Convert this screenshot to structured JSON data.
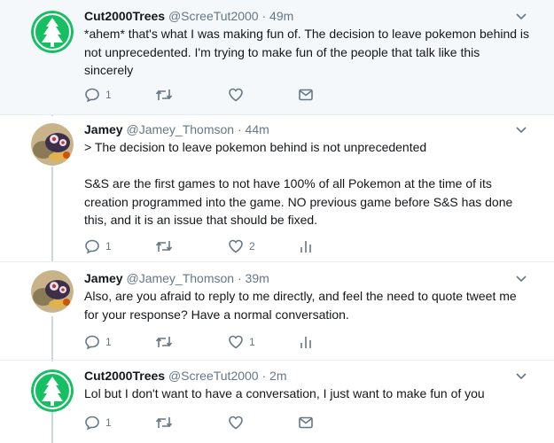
{
  "tweets": [
    {
      "name": "Cut2000Trees",
      "handle": "@ScreeTut2000",
      "time": "49m",
      "text": "*ahem* that's what I was making fun of. The decision to leave pokemon behind is not unprecedented. I'm trying to make fun of the people that talk like this sincerely",
      "reply_count": "1",
      "like_count": "",
      "avatar": "tree-avatar"
    },
    {
      "name": "Jamey",
      "handle": "@Jamey_Thomson",
      "time": "44m",
      "text": "> The decision to leave pokemon behind is not unprecedented\n\nS&S are the first games to not have 100% of all Pokemon at the time of its creation programmed into the game. NO previous game before S&S has done this, and it is an issue that should be fixed.",
      "reply_count": "1",
      "like_count": "2",
      "avatar": "jamey-avatar"
    },
    {
      "name": "Jamey",
      "handle": "@Jamey_Thomson",
      "time": "39m",
      "text": "Also, are you afraid to reply to me directly, and feel the need to quote tweet me for your response? Have a normal conversation.",
      "reply_count": "1",
      "like_count": "1",
      "avatar": "jamey-avatar"
    },
    {
      "name": "Cut2000Trees",
      "handle": "@ScreeTut2000",
      "time": "2m",
      "text": "Lol but I don't want to have a conversation, I just want to make fun of you",
      "reply_count": "1",
      "like_count": "",
      "avatar": "tree-avatar"
    }
  ],
  "separator": "·",
  "colors": {
    "icon_gray": "#657786",
    "highlight_bg": "#f5f8fa",
    "tree_green": "#17bf63"
  }
}
